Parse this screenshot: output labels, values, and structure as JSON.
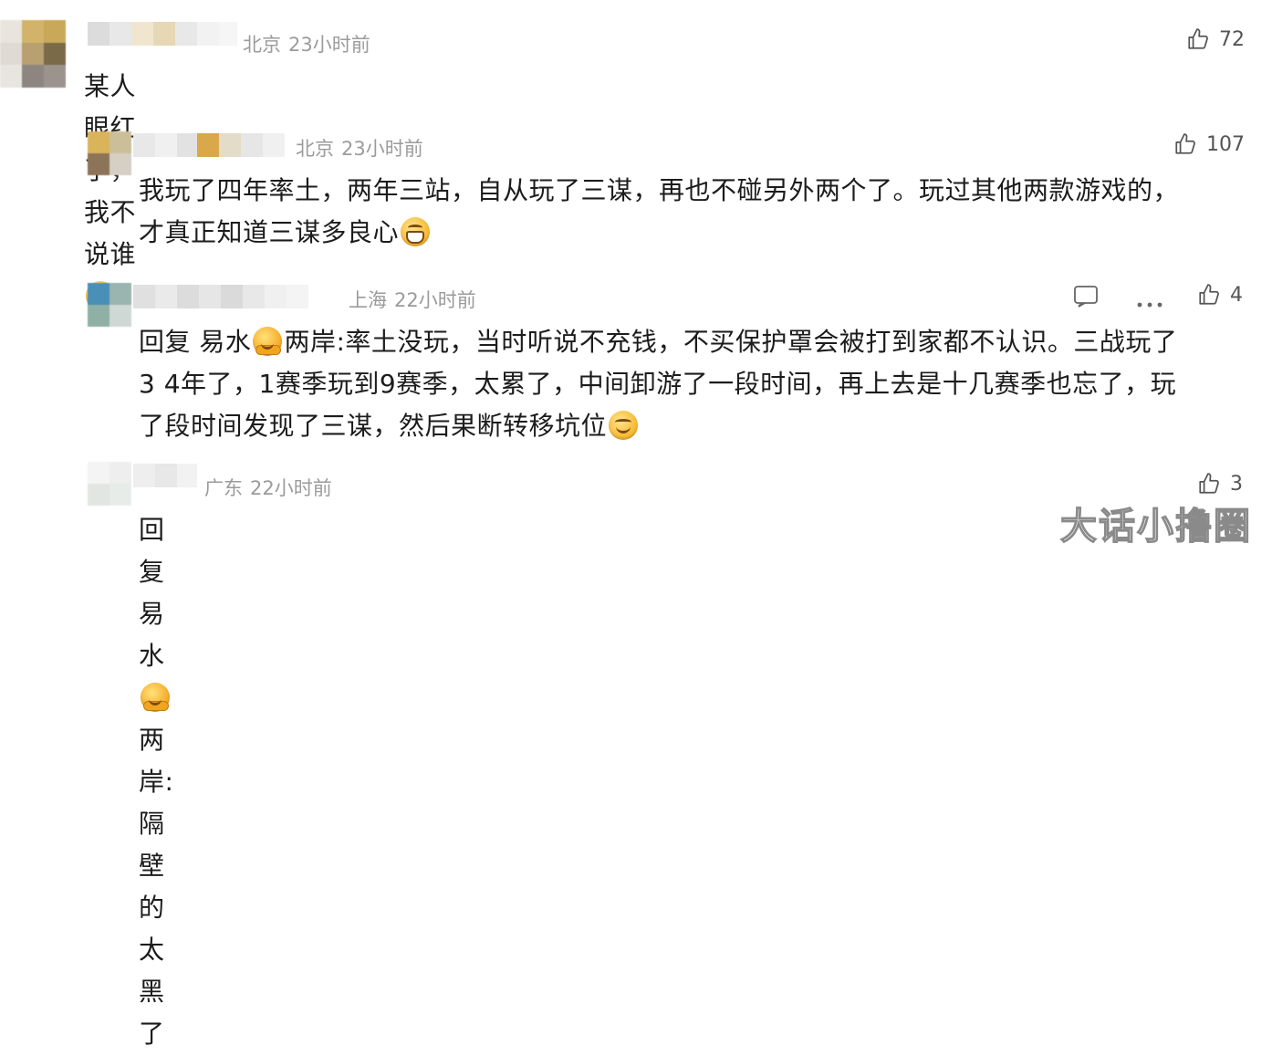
{
  "comments": [
    {
      "location": "北京",
      "time": "23小时前",
      "likes": "72",
      "text": "某人眼红了，我不说谁",
      "emoji": "grin-emoji"
    },
    {
      "location": "北京",
      "time": "23小时前",
      "likes": "107",
      "text_line1": "我玩了四年率土，两年三站，自从玩了三谋，再也不碰另外两个了。玩过其他两款游戏的，",
      "text_line2": "才真正知道三谋多良心",
      "emoji": "grin-emoji"
    },
    {
      "location": "上海",
      "time": "22小时前",
      "likes": "4",
      "reply_prefix": "回复",
      "reply_to_a": "易水",
      "reply_to_b": "两岸:",
      "text_line1": "率土没玩，当时听说不充钱，不买保护罩会被打到家都不认识。三战玩了",
      "text_line2": "3 4年了，1赛季玩到9赛季，太累了，中间卸游了一段时间，再上去是十几赛季也忘了，玩",
      "text_line3": "了段时间发现了三谋，然后果断转移坑位",
      "emoji": "smile-emoji"
    },
    {
      "location": "广东",
      "time": "22小时前",
      "likes": "3",
      "reply_prefix": "回复",
      "reply_to_a": "易水",
      "reply_to_b": "两岸:",
      "text": "隔壁的太黑了"
    }
  ],
  "watermark": "大话小撸圈",
  "icons": [
    "thumbs-up-icon",
    "comment-icon",
    "more-icon"
  ]
}
